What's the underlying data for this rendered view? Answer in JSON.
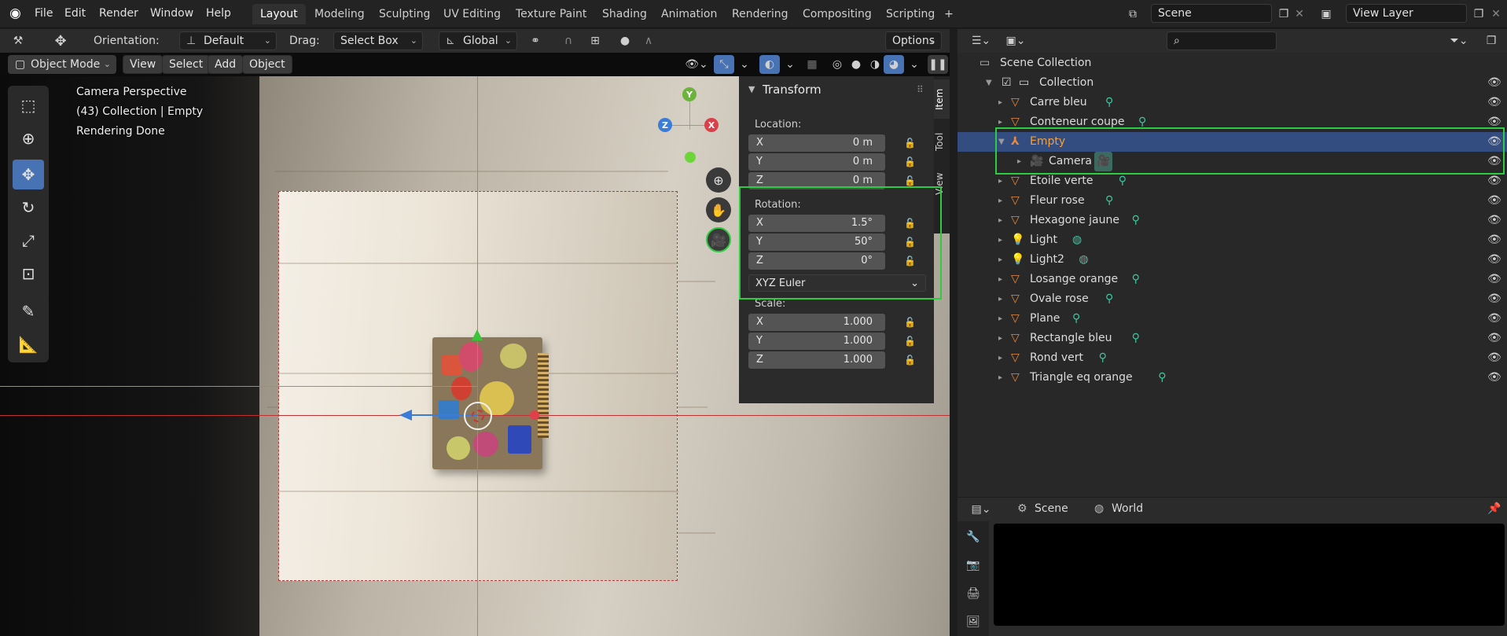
{
  "app": {
    "menus": [
      "File",
      "Edit",
      "Render",
      "Window",
      "Help"
    ],
    "workspace_tabs": [
      "Layout",
      "Modeling",
      "Sculpting",
      "UV Editing",
      "Texture Paint",
      "Shading",
      "Animation",
      "Rendering",
      "Compositing",
      "Scripting"
    ],
    "active_tab": "Layout",
    "scene_name": "Scene",
    "view_layer_name": "View Layer"
  },
  "viewport": {
    "header": {
      "orientation_label": "Orientation:",
      "orientation_value": "Default",
      "drag_label": "Drag:",
      "drag_value": "Select Box",
      "transform_space": "Global",
      "options_label": "Options"
    },
    "header2": {
      "mode": "Object Mode",
      "view": "View",
      "select": "Select",
      "add": "Add",
      "object": "Object"
    },
    "overlay_lines": [
      "Camera Perspective",
      "(43) Collection | Empty",
      "Rendering Done"
    ],
    "gizmo": {
      "x": "X",
      "y": "Y",
      "z": "Z"
    }
  },
  "npanel": {
    "title": "Transform",
    "location_label": "Location:",
    "location": [
      {
        "axis": "X",
        "value": "0 m"
      },
      {
        "axis": "Y",
        "value": "0 m"
      },
      {
        "axis": "Z",
        "value": "0 m"
      }
    ],
    "rotation_label": "Rotation:",
    "rotation": [
      {
        "axis": "X",
        "value": "1.5°"
      },
      {
        "axis": "Y",
        "value": "50°"
      },
      {
        "axis": "Z",
        "value": "0°"
      }
    ],
    "rotation_mode": "XYZ Euler",
    "scale_label": "Scale:",
    "scale": [
      {
        "axis": "X",
        "value": "1.000"
      },
      {
        "axis": "Y",
        "value": "1.000"
      },
      {
        "axis": "Z",
        "value": "1.000"
      }
    ],
    "tabs": [
      "Item",
      "Tool",
      "View"
    ]
  },
  "outliner": {
    "scene_collection": "Scene Collection",
    "collection": "Collection",
    "items": [
      {
        "name": "Carre bleu",
        "type": "mesh"
      },
      {
        "name": "Conteneur coupe",
        "type": "mesh"
      },
      {
        "name": "Empty",
        "type": "empty",
        "selected": true
      },
      {
        "name": "Camera",
        "type": "camera",
        "child": true
      },
      {
        "name": "Etoile verte",
        "type": "mesh"
      },
      {
        "name": "Fleur rose",
        "type": "mesh"
      },
      {
        "name": "Hexagone jaune",
        "type": "mesh"
      },
      {
        "name": "Light",
        "type": "light"
      },
      {
        "name": "Light2",
        "type": "light"
      },
      {
        "name": "Losange orange",
        "type": "mesh"
      },
      {
        "name": "Ovale rose",
        "type": "mesh"
      },
      {
        "name": "Plane",
        "type": "mesh"
      },
      {
        "name": "Rectangle bleu",
        "type": "mesh"
      },
      {
        "name": "Rond vert",
        "type": "mesh"
      },
      {
        "name": "Triangle eq orange",
        "type": "mesh"
      }
    ]
  },
  "properties": {
    "scene_label": "Scene",
    "world_label": "World"
  }
}
